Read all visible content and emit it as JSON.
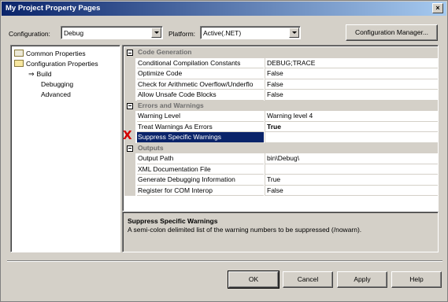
{
  "window": {
    "title": "My Project Property Pages",
    "close_label": "×"
  },
  "toolbar": {
    "configuration_label": "Configuration:",
    "configuration_value": "Debug",
    "platform_label": "Platform:",
    "platform_value": "Active(.NET)",
    "config_manager_label": "Configuration Manager..."
  },
  "tree": {
    "common": "Common Properties",
    "config": "Configuration Properties",
    "build": "Build",
    "debugging": "Debugging",
    "advanced": "Advanced"
  },
  "grid": {
    "categories": [
      "Code Generation",
      "Errors and Warnings",
      "Outputs"
    ],
    "code_generation": [
      {
        "name": "Conditional Compilation Constants",
        "value": "DEBUG;TRACE"
      },
      {
        "name": "Optimize Code",
        "value": "False"
      },
      {
        "name": "Check for Arithmetic Overflow/Underflo",
        "value": "False"
      },
      {
        "name": "Allow Unsafe Code Blocks",
        "value": "False"
      }
    ],
    "errors_warnings": [
      {
        "name": "Warning Level",
        "value": "Warning level 4"
      },
      {
        "name": "Treat Warnings As Errors",
        "value": "True"
      },
      {
        "name": "Suppress Specific Warnings",
        "value": ""
      }
    ],
    "outputs": [
      {
        "name": "Output Path",
        "value": "bin\\Debug\\"
      },
      {
        "name": "XML Documentation File",
        "value": ""
      },
      {
        "name": "Generate Debugging Information",
        "value": "True"
      },
      {
        "name": "Register for COM Interop",
        "value": "False"
      }
    ],
    "marker": "X"
  },
  "description": {
    "title": "Suppress Specific Warnings",
    "text": "A semi-colon delimited list of the warning numbers to be suppressed (/nowarn)."
  },
  "buttons": {
    "ok": "OK",
    "cancel": "Cancel",
    "apply": "Apply",
    "help": "Help"
  }
}
